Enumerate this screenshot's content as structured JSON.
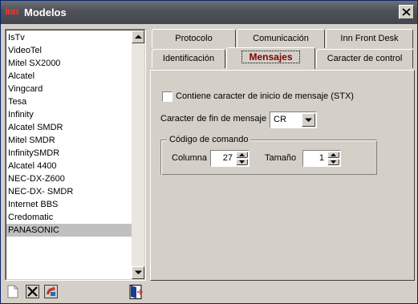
{
  "window": {
    "title": "Modelos",
    "logo_text": "inn",
    "icons": {
      "close": "close-icon",
      "logo": "inn-logo-icon"
    }
  },
  "models_list": {
    "items": [
      "IsTv",
      "VideoTel",
      "Mitel SX2000",
      "Alcatel",
      "Vingcard",
      "Tesa",
      "Infinity",
      "Alcatel SMDR",
      "Mitel SMDR",
      "InfinitySMDR",
      "Alcatel 4400",
      "NEC-DX-Z600",
      "NEC-DX- SMDR",
      "Internet BBS",
      "Credomatic",
      "PANASONIC"
    ],
    "selected": "PANASONIC"
  },
  "toolbar": {
    "icons": [
      "new-document-icon",
      "delete-x-icon",
      "edit-icon",
      "exit-door-icon"
    ]
  },
  "tabs": {
    "row_back": [
      "Protocolo",
      "Comunicación",
      "Inn Front Desk"
    ],
    "row_front": [
      "Identificación",
      "Mensajes",
      "Caracter de control"
    ],
    "active": "Mensajes"
  },
  "mensajes": {
    "stx_label": "Contiene caracter de inicio de mensaje (STX)",
    "stx_checked": false,
    "fin_label": "Caracter de fin de mensaje",
    "fin_value": "CR",
    "group_title": "Código de comando",
    "columna_label": "Columna",
    "columna_value": "27",
    "tamano_label": "Tamaño",
    "tamano_value": "1"
  },
  "colors": {
    "title_bar": "#4b4f55",
    "active_tab_text": "#800000",
    "selected_row": "#c0c0c0"
  }
}
